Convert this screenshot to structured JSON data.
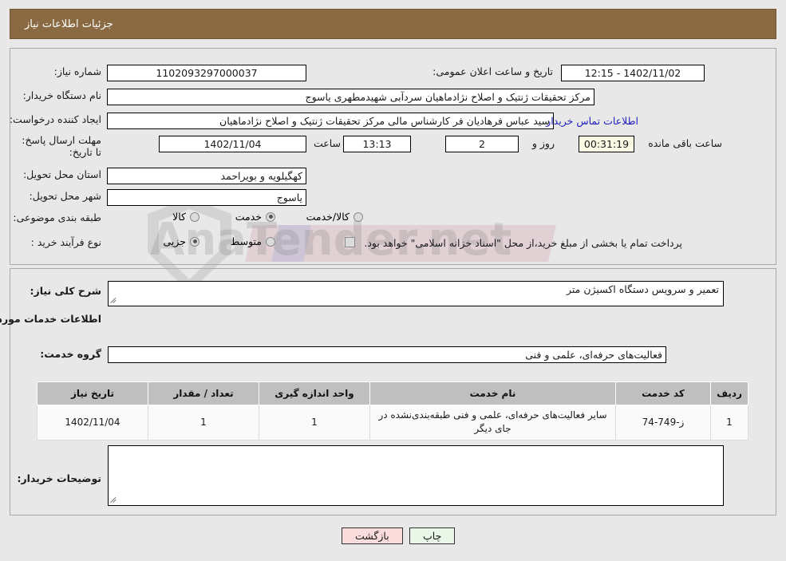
{
  "header": {
    "title": "جزئیات اطلاعات نیاز"
  },
  "top_form": {
    "need_number_label": "شماره نیاز:",
    "need_number_value": "1102093297000037",
    "announce_datetime_label": "تاریخ و ساعت اعلان عمومی:",
    "announce_datetime_value": "1402/11/02 - 12:15",
    "buyer_org_label": "نام دستگاه خریدار:",
    "buyer_org_value": "مرکز تحقیقات ژنتیک و اصلاح نژادماهیان سردآبی شهیدمطهری یاسوج",
    "request_creator_label": "ایجاد کننده درخواست:",
    "request_creator_value": "سید عباس   فرهادیان فر کارشناس مالی مرکز تحقیقات ژنتیک و اصلاح نژادماهیان",
    "buyer_contact_link": "اطلاعات تماس خریدار",
    "deadline_label": "مهلت ارسال پاسخ: تا تاریخ:",
    "deadline_date_value": "1402/11/04",
    "hour_label": "ساعت",
    "deadline_time_value": "13:13",
    "days_value": "2",
    "days_label": "روز و",
    "remaining_time_value": "00:31:19",
    "remaining_label": "ساعت باقی مانده",
    "province_label": "استان محل تحویل:",
    "province_value": "کهگیلویه و بویراحمد",
    "city_label": "شهر محل تحویل:",
    "city_value": "یاسوج",
    "category_label": "طبقه بندی موضوعی:",
    "category_options": [
      {
        "label": "کالا",
        "selected": false
      },
      {
        "label": "خدمت",
        "selected": true
      },
      {
        "label": "کالا/خدمت",
        "selected": false
      }
    ],
    "process_label": "نوع فرآیند خرید :",
    "process_options": [
      {
        "label": "جزیی",
        "selected": true
      },
      {
        "label": "متوسط",
        "selected": false
      }
    ],
    "treasury_checkbox_checked": false,
    "treasury_note": "پرداخت تمام یا بخشی از مبلغ خرید،از محل \"اسناد خزانه اسلامی\" خواهد بود."
  },
  "bottom_form": {
    "general_desc_label": "شرح کلی نیاز:",
    "general_desc_value": "تعمیر و سرویس دستگاه اکسیژن متر",
    "services_section_title": "اطلاعات خدمات مورد نیاز",
    "service_group_label": "گروه خدمت:",
    "service_group_value": "فعالیت‌های حرفه‌ای، علمی و فنی",
    "buyer_notes_label": "توضیحات خریدار:",
    "buyer_notes_value": ""
  },
  "table": {
    "columns": [
      "ردیف",
      "کد خدمت",
      "نام خدمت",
      "واحد اندازه گیری",
      "تعداد / مقدار",
      "تاریخ نیاز"
    ],
    "rows": [
      {
        "index": "1",
        "code": "ز-749-74",
        "name": "سایر فعالیت‌های حرفه‌ای، علمی و فنی طبقه‌بندی‌نشده در جای دیگر",
        "unit": "1",
        "qty": "1",
        "need_date": "1402/11/04"
      }
    ]
  },
  "footer": {
    "print_label": "چاپ",
    "back_label": "بازگشت"
  },
  "watermark": {
    "text": "AnaTender.net"
  },
  "colors": {
    "header_bg": "#8a6a42",
    "page_bg": "#e8e8e8",
    "link": "#2020c0",
    "table_header_bg": "#bfbfbf",
    "print_btn_bg": "#e9f7e9",
    "back_btn_bg": "#fbdcdc"
  }
}
